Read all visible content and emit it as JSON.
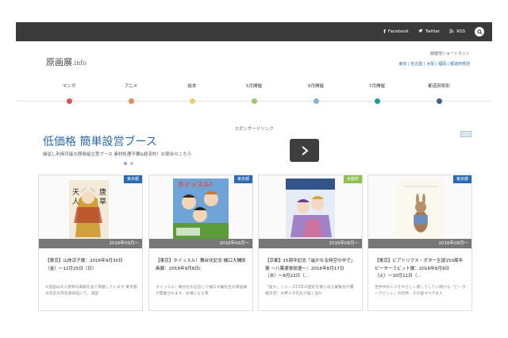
{
  "topbar": {
    "facebook": "Facebook",
    "twitter": "Twitter",
    "rss": "RSS"
  },
  "header": {
    "logo_main": "原画展",
    "logo_suffix": ".info",
    "shortcut_label": "開催地ショートカット",
    "shortcut_links": "東京 | 名古屋 | 大阪 | 福岡 | 都道府県別"
  },
  "nav": [
    {
      "label": "マンガ",
      "color": "#d9545a"
    },
    {
      "label": "アニメ",
      "color": "#e8895a"
    },
    {
      "label": "絵本",
      "color": "#e8cf6a"
    },
    {
      "label": "5月開催",
      "color": "#9cc96a"
    },
    {
      "label": "6月開催",
      "color": "#7fb5d8"
    },
    {
      "label": "7月開催",
      "color": "#1f9a9a"
    },
    {
      "label": "都道府県別",
      "color": "#3d5f8f"
    }
  ],
  "ad": {
    "sponsor": "スポンサードリンク",
    "title": "低価格 簡単設営ブース",
    "subtitle": "繰返し利用可能な簡易組立型ブース 素材処理不要&経済的！お問合せこちら"
  },
  "cards": [
    {
      "tag": "東京都",
      "tag_color": "#2a6ab0",
      "date": "2016年09月〜",
      "title": "【東京】山岸凉子展：2016年9月30日（金）〜12月25日（日）",
      "desc": "※漫画は天人唐草の表紙を含て掲載しています 東京都文京区の弥生美術館にて、漫画"
    },
    {
      "tag": "東京都",
      "tag_color": "#2a6ab0",
      "date": "2016年09月〜",
      "title": "【東京】ホイッスル！舞台化記念 樋口大輔原画展：2016年9月8日(",
      "desc": "ホイッスル！舞台化を記念して樋口大輔先生の原画展が開催されます。会場となる東"
    },
    {
      "tag": "京都府",
      "tag_color": "#8cc152",
      "date": "2016年08月〜",
      "title": "【京都】15周年記念「遥かなる時空の中で」展 〜八葉選挙総選〜：2016年8月17日（水）〜8月22日（...",
      "desc": "「遥か」シリーズ15年の歴史を振り返る展覧会が開催決定！水野十子先生が描く遥か"
    },
    {
      "tag": "東京都",
      "tag_color": "#2a6ab0",
      "date": "2016年08月〜",
      "title": "【東京】ビアトリクス・ポター生誕150周年 ピーターラビット展：2016年8月9日（火）〜10月11日（...",
      "desc": "世界中の人々をやさしく癒してしてい続ける「ピーターラビット」の世界、その愛すべき主人"
    }
  ]
}
